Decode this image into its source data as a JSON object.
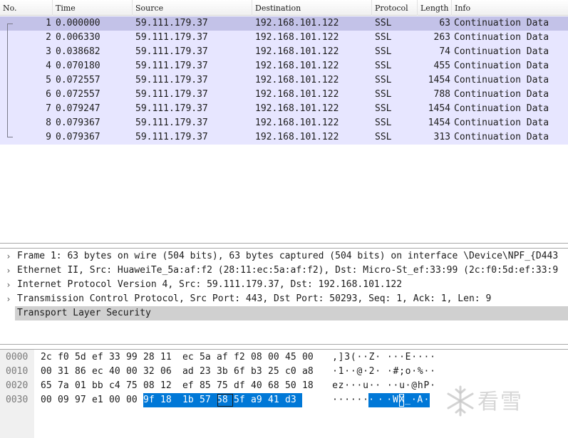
{
  "packet_list": {
    "columns": [
      "No.",
      "Time",
      "Source",
      "Destination",
      "Protocol",
      "Length",
      "Info"
    ],
    "rows": [
      {
        "no": "1",
        "time": "0.000000",
        "source": "59.111.179.37",
        "destination": "192.168.101.122",
        "protocol": "SSL",
        "length": "63",
        "info": "Continuation Data",
        "selected": true
      },
      {
        "no": "2",
        "time": "0.006330",
        "source": "59.111.179.37",
        "destination": "192.168.101.122",
        "protocol": "SSL",
        "length": "263",
        "info": "Continuation Data"
      },
      {
        "no": "3",
        "time": "0.038682",
        "source": "59.111.179.37",
        "destination": "192.168.101.122",
        "protocol": "SSL",
        "length": "74",
        "info": "Continuation Data"
      },
      {
        "no": "4",
        "time": "0.070180",
        "source": "59.111.179.37",
        "destination": "192.168.101.122",
        "protocol": "SSL",
        "length": "455",
        "info": "Continuation Data"
      },
      {
        "no": "5",
        "time": "0.072557",
        "source": "59.111.179.37",
        "destination": "192.168.101.122",
        "protocol": "SSL",
        "length": "1454",
        "info": "Continuation Data"
      },
      {
        "no": "6",
        "time": "0.072557",
        "source": "59.111.179.37",
        "destination": "192.168.101.122",
        "protocol": "SSL",
        "length": "788",
        "info": "Continuation Data"
      },
      {
        "no": "7",
        "time": "0.079247",
        "source": "59.111.179.37",
        "destination": "192.168.101.122",
        "protocol": "SSL",
        "length": "1454",
        "info": "Continuation Data"
      },
      {
        "no": "8",
        "time": "0.079367",
        "source": "59.111.179.37",
        "destination": "192.168.101.122",
        "protocol": "SSL",
        "length": "1454",
        "info": "Continuation Data"
      },
      {
        "no": "9",
        "time": "0.079367",
        "source": "59.111.179.37",
        "destination": "192.168.101.122",
        "protocol": "SSL",
        "length": "313",
        "info": "Continuation Data"
      }
    ]
  },
  "packet_details": {
    "items": [
      {
        "text": "Frame 1: 63 bytes on wire (504 bits), 63 bytes captured (504 bits) on interface \\Device\\NPF_{D443",
        "expandable": true
      },
      {
        "text": "Ethernet II, Src: HuaweiTe_5a:af:f2 (28:11:ec:5a:af:f2), Dst: Micro-St_ef:33:99 (2c:f0:5d:ef:33:9",
        "expandable": true
      },
      {
        "text": "Internet Protocol Version 4, Src: 59.111.179.37, Dst: 192.168.101.122",
        "expandable": true
      },
      {
        "text": "Transmission Control Protocol, Src Port: 443, Dst Port: 50293, Seq: 1, Ack: 1, Len: 9",
        "expandable": true
      },
      {
        "text": "Transport Layer Security",
        "expandable": false,
        "selected": true
      }
    ]
  },
  "packet_bytes": {
    "rows": [
      {
        "offset": "0000",
        "hex": [
          "2c",
          "f0",
          "5d",
          "ef",
          "33",
          "99",
          "28",
          "11",
          "ec",
          "5a",
          "af",
          "f2",
          "08",
          "00",
          "45",
          "00"
        ],
        "ascii": [
          ",",
          "]",
          "3",
          "(",
          "·",
          "·",
          "Z",
          "·",
          "·",
          "·",
          "·",
          "E",
          "·",
          "·",
          "·",
          "·"
        ]
      },
      {
        "offset": "0010",
        "hex": [
          "00",
          "31",
          "86",
          "ec",
          "40",
          "00",
          "32",
          "06",
          "ad",
          "23",
          "3b",
          "6f",
          "b3",
          "25",
          "c0",
          "a8"
        ],
        "ascii": [
          "·",
          "1",
          "·",
          "·",
          "@",
          "·",
          "2",
          "·",
          "·",
          "#",
          ";",
          "o",
          "·",
          "%",
          "·",
          "·"
        ]
      },
      {
        "offset": "0020",
        "hex": [
          "65",
          "7a",
          "01",
          "bb",
          "c4",
          "75",
          "08",
          "12",
          "ef",
          "85",
          "75",
          "df",
          "40",
          "68",
          "50",
          "18"
        ],
        "ascii": [
          "e",
          "z",
          "·",
          "·",
          "·",
          "u",
          "·",
          "·",
          "·",
          "·",
          "u",
          "·",
          "@",
          "h",
          "P",
          "·"
        ]
      },
      {
        "offset": "0030",
        "hex": [
          "00",
          "09",
          "97",
          "e1",
          "00",
          "00",
          "9f",
          "18",
          "1b",
          "57",
          "58",
          "5f",
          "a9",
          "41",
          "d3"
        ],
        "ascii": [
          "·",
          "·",
          "·",
          "·",
          "·",
          "·",
          "·",
          "·",
          "·",
          "W",
          "X",
          "_",
          "·",
          "A",
          "·"
        ]
      }
    ],
    "highlight": {
      "row": 3,
      "from": 6,
      "to": 14
    },
    "cursor": {
      "row": 3,
      "index": 10
    }
  },
  "watermark": {
    "text": "看雪",
    "icon": "snowflake-icon"
  },
  "colors": {
    "row_bg": "#e7e6ff",
    "row_selected": "#c3c2e8",
    "byte_highlight": "#0078d7",
    "detail_selected": "#d0d0d0"
  }
}
